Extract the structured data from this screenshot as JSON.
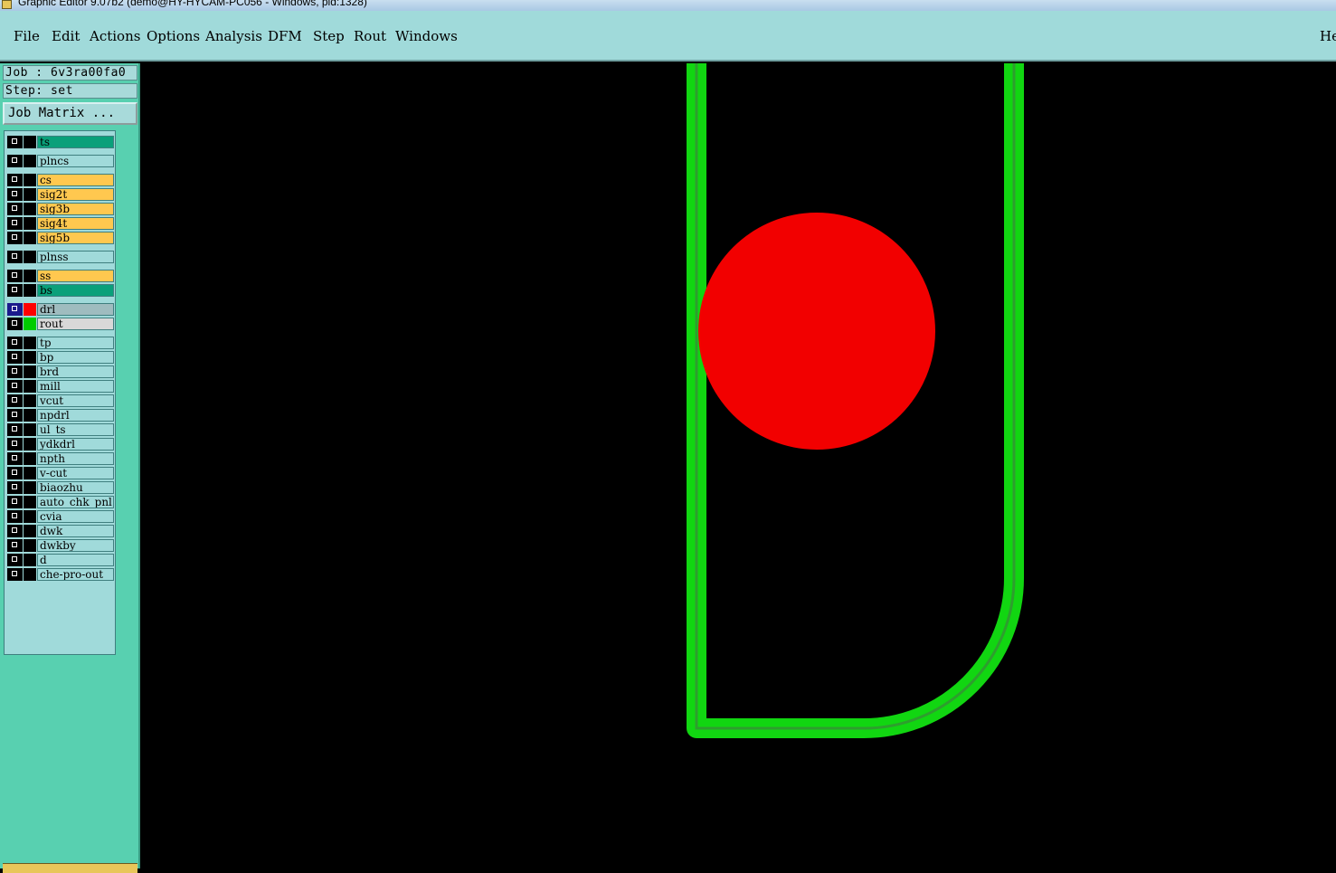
{
  "window": {
    "title": "Graphic Editor 9.07b2 (demo@HY-HYCAM-PC056 - Windows, pid:1328)"
  },
  "menu": {
    "items": [
      "File",
      "Edit",
      "Actions",
      "Options",
      "Analysis",
      "DFM",
      "Step",
      "Rout",
      "Windows"
    ],
    "help": "He"
  },
  "job": {
    "job_text": "Job : 6v3ra00fa0",
    "step_text": "Step: set",
    "matrix_button": "Job Matrix ..."
  },
  "layers": [
    {
      "name": "ts",
      "color": "#0aa07a",
      "swatch": "#000000"
    },
    {
      "name": "plncs",
      "color": "#a0dada",
      "swatch": "#000000"
    },
    {
      "name": "cs",
      "color": "#ffc84f",
      "swatch": "#000000"
    },
    {
      "name": "sig2t",
      "color": "#ffc84f",
      "swatch": "#000000"
    },
    {
      "name": "sig3b",
      "color": "#ffc84f",
      "swatch": "#000000"
    },
    {
      "name": "sig4t",
      "color": "#ffc84f",
      "swatch": "#000000"
    },
    {
      "name": "sig5b",
      "color": "#ffc84f",
      "swatch": "#000000"
    },
    {
      "name": "plnss",
      "color": "#a0dada",
      "swatch": "#000000"
    },
    {
      "name": "ss",
      "color": "#ffc84f",
      "swatch": "#000000"
    },
    {
      "name": "bs",
      "color": "#0aa07a",
      "swatch": "#000000"
    },
    {
      "name": "drl",
      "color": "#9fbcbf",
      "swatch": "#ff0000",
      "active": true
    },
    {
      "name": "rout",
      "color": "#d8d8d8",
      "swatch": "#00cc00"
    },
    {
      "name": "tp",
      "color": "#a0dada",
      "swatch": "#000000"
    },
    {
      "name": "bp",
      "color": "#a0dada",
      "swatch": "#000000"
    },
    {
      "name": "brd",
      "color": "#a0dada",
      "swatch": "#000000"
    },
    {
      "name": "mill",
      "color": "#a0dada",
      "swatch": "#000000"
    },
    {
      "name": "vcut",
      "color": "#a0dada",
      "swatch": "#000000"
    },
    {
      "name": "npdrl",
      "color": "#a0dada",
      "swatch": "#000000"
    },
    {
      "name": "ul_ts",
      "color": "#a0dada",
      "swatch": "#000000"
    },
    {
      "name": "ydkdrl",
      "color": "#a0dada",
      "swatch": "#000000"
    },
    {
      "name": "npth",
      "color": "#a0dada",
      "swatch": "#000000"
    },
    {
      "name": "v-cut",
      "color": "#a0dada",
      "swatch": "#000000"
    },
    {
      "name": "biaozhu",
      "color": "#a0dada",
      "swatch": "#000000"
    },
    {
      "name": "auto_chk_pnl",
      "color": "#a0dada",
      "swatch": "#000000"
    },
    {
      "name": "cvia",
      "color": "#a0dada",
      "swatch": "#000000"
    },
    {
      "name": "dwk",
      "color": "#a0dada",
      "swatch": "#000000"
    },
    {
      "name": "dwkby",
      "color": "#a0dada",
      "swatch": "#000000"
    },
    {
      "name": "d",
      "color": "#a0dada",
      "swatch": "#000000"
    },
    {
      "name": "che-pro-out",
      "color": "#a0dada",
      "swatch": "#000000"
    }
  ],
  "colors": {
    "menubar": "#a0dada",
    "panel": "#58d0b0",
    "canvas": "#000000",
    "rout_path": "#11d611",
    "drill_pad": "#f20000",
    "overlap": "#f0d800"
  }
}
